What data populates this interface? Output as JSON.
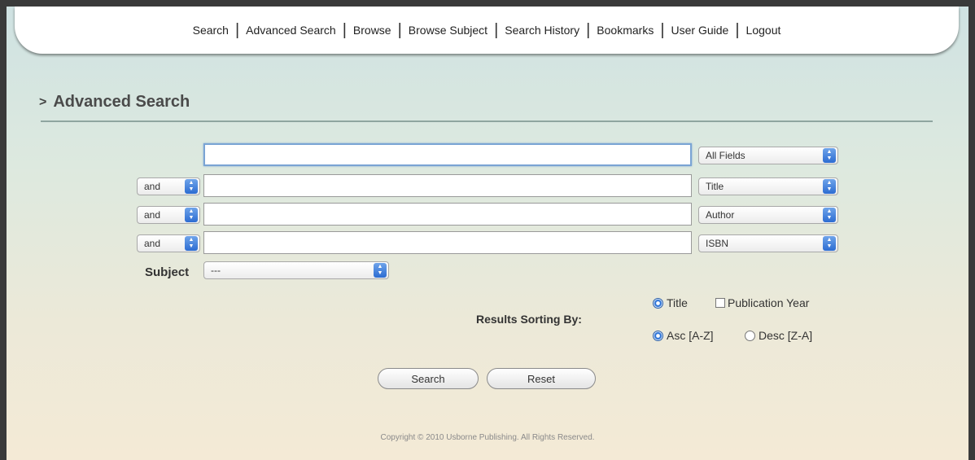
{
  "nav": {
    "items": [
      {
        "label": "Search"
      },
      {
        "label": "Advanced Search"
      },
      {
        "label": "Browse"
      },
      {
        "label": "Browse Subject"
      },
      {
        "label": "Search History"
      },
      {
        "label": "Bookmarks"
      },
      {
        "label": "User Guide"
      },
      {
        "label": "Logout"
      }
    ],
    "separator": "|"
  },
  "page": {
    "arrow_glyph": ">",
    "title": "Advanced Search"
  },
  "search": {
    "rows": [
      {
        "query": "",
        "field": "All Fields"
      },
      {
        "operator": "and",
        "query": "",
        "field": "Title"
      },
      {
        "operator": "and",
        "query": "",
        "field": "Author"
      },
      {
        "operator": "and",
        "query": "",
        "field": "ISBN"
      }
    ],
    "subject_label": "Subject",
    "subject_value": "---"
  },
  "sorting": {
    "label": "Results Sorting By:",
    "sort_by_options": [
      {
        "label": "Title",
        "selected": true
      },
      {
        "label": "Publication Year",
        "selected": false
      }
    ],
    "order_options": [
      {
        "label": "Asc [A-Z]",
        "selected": true
      },
      {
        "label": "Desc [Z-A]",
        "selected": false
      }
    ]
  },
  "buttons": {
    "search_label": "Search",
    "reset_label": "Reset"
  },
  "footer": {
    "copyright": "Copyright © 2010 Usborne Publishing. All Rights Reserved."
  }
}
